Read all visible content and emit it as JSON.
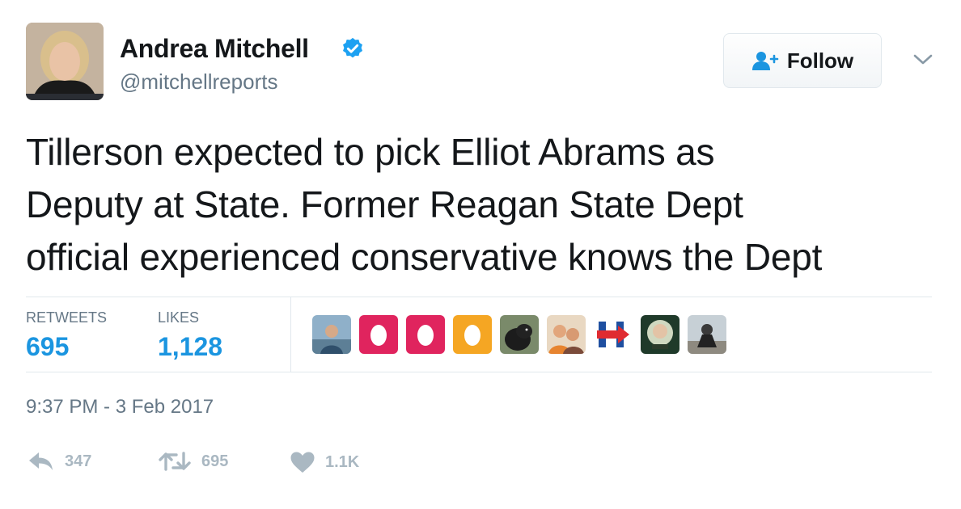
{
  "author": {
    "display_name": "Andrea Mitchell",
    "handle": "@mitchellreports",
    "verified": true,
    "avatar_icon": "profile-photo"
  },
  "follow_button": {
    "label": "Follow",
    "icon": "add-user-icon"
  },
  "menu": {
    "icon": "chevron-down-icon"
  },
  "tweet": {
    "lines": [
      "Tillerson expected to pick Elliot Abrams as",
      "Deputy at State. Former Reagan State Dept",
      "official experienced conservative knows the Dept"
    ]
  },
  "stats": {
    "retweets_label": "RETWEETS",
    "retweets_value": "695",
    "likes_label": "LIKES",
    "likes_value": "1,128"
  },
  "likers": [
    {
      "icon": "user-photo"
    },
    {
      "icon": "default-egg-avatar"
    },
    {
      "icon": "default-egg-avatar"
    },
    {
      "icon": "default-egg-avatar"
    },
    {
      "icon": "dog-photo"
    },
    {
      "icon": "couple-photo"
    },
    {
      "icon": "h-logo-avatar"
    },
    {
      "icon": "user-photo"
    },
    {
      "icon": "user-photo"
    }
  ],
  "timestamp": "9:37 PM - 3 Feb 2017",
  "actions": {
    "reply_count": "347",
    "retweet_count": "695",
    "like_count": "1.1K"
  },
  "colors": {
    "accent": "#1b95e0",
    "secondary_text": "#657786",
    "divider": "#e1e8ed",
    "action_gray": "#aab8c2",
    "egg_red": "#e0245e",
    "egg_orange": "#f5a623"
  }
}
